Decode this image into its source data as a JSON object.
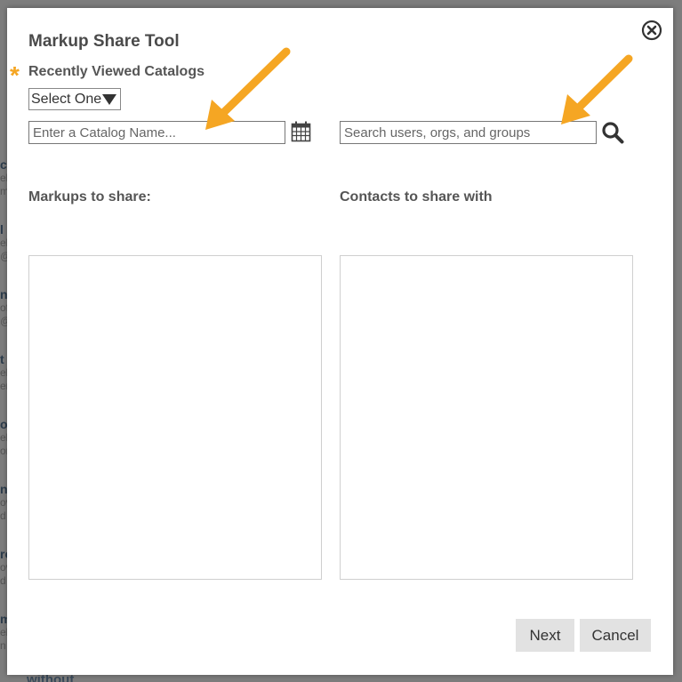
{
  "background": {
    "fragments": [
      "c",
      "el",
      "m",
      "l",
      "el",
      "@",
      "n",
      "of",
      "@",
      "t",
      "el",
      "er",
      "o",
      "el",
      "on",
      "ni",
      "ov",
      "d",
      "ro",
      "ov",
      "d",
      "m",
      "el",
      "n"
    ],
    "bottom_text": "without"
  },
  "modal": {
    "title": "Markup Share Tool",
    "required_marker": "*",
    "catalog_label": "Recently Viewed Catalogs",
    "catalog_select": {
      "selected": "Select One"
    },
    "catalog_input": {
      "value": "",
      "placeholder": "Enter a Catalog Name..."
    },
    "search_input": {
      "value": "",
      "placeholder": "Search users, orgs, and groups"
    },
    "markups_label": "Markups to share:",
    "contacts_label": "Contacts to share with",
    "markups": [],
    "contacts": [],
    "buttons": {
      "next": "Next",
      "cancel": "Cancel"
    }
  },
  "icons": {
    "close": "close-circle-icon",
    "calendar": "calendar-icon",
    "search": "search-icon"
  },
  "colors": {
    "accent_arrow": "#f5a623",
    "button_bg": "#e2e2e2",
    "label_text": "#555555"
  }
}
